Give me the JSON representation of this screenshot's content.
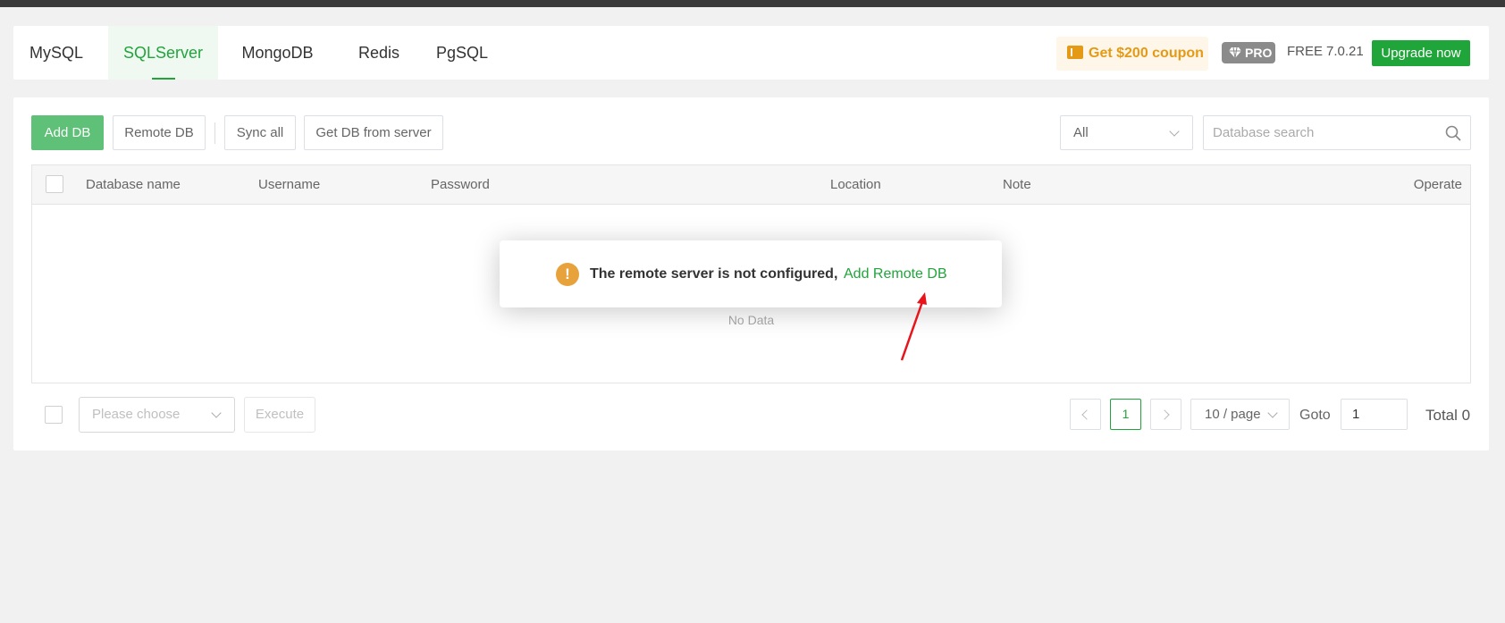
{
  "tabs": [
    {
      "label": "MySQL"
    },
    {
      "label": "SQLServer",
      "active": true
    },
    {
      "label": "MongoDB"
    },
    {
      "label": "Redis"
    },
    {
      "label": "PgSQL"
    }
  ],
  "header": {
    "coupon": "Get $200 coupon",
    "pro_badge": "PRO",
    "plan": "FREE",
    "version": "7.0.21",
    "upgrade": "Upgrade now"
  },
  "toolbar": {
    "add_db": "Add DB",
    "remote_db": "Remote DB",
    "sync_all": "Sync all",
    "get_db_from_server": "Get DB from server",
    "filter_value": "All",
    "search_placeholder": "Database search"
  },
  "table": {
    "columns": [
      "Database name",
      "Username",
      "Password",
      "Location",
      "Note",
      "Operate"
    ],
    "rows": [],
    "empty_text": "No Data"
  },
  "footer": {
    "batch_placeholder": "Please choose",
    "execute": "Execute",
    "current_page": "1",
    "per_page": "10 / page",
    "goto_label": "Goto",
    "goto_value": "1",
    "total": "Total 0"
  },
  "toast": {
    "message": "The remote server is not configured,",
    "link": "Add Remote DB",
    "icon": "warning-icon"
  },
  "colors": {
    "accent": "#20a53a",
    "primary_button": "#5ec177",
    "coupon": "#e59a15",
    "warning": "#e8a23b",
    "annotation_arrow": "#e8141b"
  }
}
